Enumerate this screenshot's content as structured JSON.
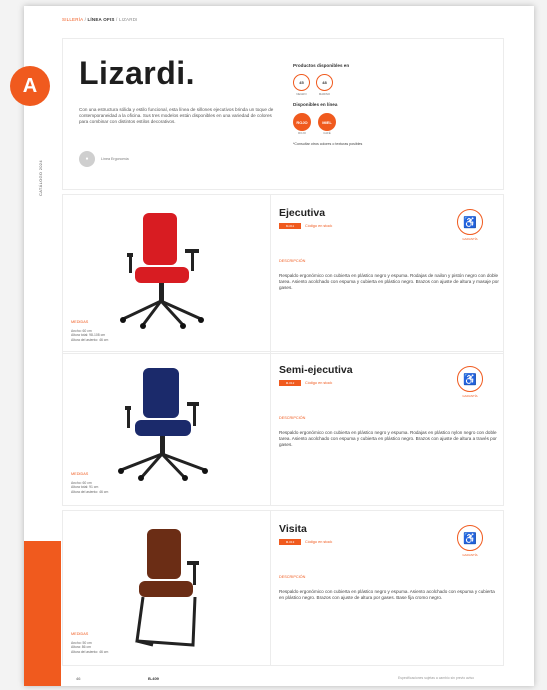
{
  "badge": "A",
  "side_label": "CATÁLOGO 2024",
  "breadcrumb": {
    "part1": "SILLERÍA",
    "part2": "LÍNEA OFIS",
    "part3": "LIZARDI"
  },
  "hero": {
    "title": "Lizardi.",
    "intro": "Con una estructura sólida y estilo funcional, esta línea de sillones ejecutivos brinda un toque de contemporaneidad a la oficina. Sus tres modelos están disponibles en una variedad de colores para combinar con distintos estilos decorativos.",
    "logo_text": "Línea Ergonomía"
  },
  "availability": {
    "title": "Productos disponibles en",
    "rings": [
      {
        "code": "45",
        "caption": "NEGRO"
      },
      {
        "code": "48",
        "caption": "MARINO"
      }
    ],
    "finish_title": "Disponibles en línea",
    "fills": [
      {
        "code": "ROJO",
        "caption": "ROJO"
      },
      {
        "code": "MIEL",
        "caption": "CAFÉ"
      }
    ],
    "note": "*Consultar otros colores o texturas posibles"
  },
  "products": [
    {
      "name": "Ejecutiva",
      "code": "M-011",
      "code_text": "Código en stock",
      "desc_label": "DESCRIPCIÓN",
      "desc": "Respaldo ergonómico con cubierta en plástico negro y espuma. Rodajas de nailon y pistón negro con doble tarea. Asiento acolchado con espuma y cubierta en plástico negro. Brazos con ajuste de altura y masaje por gases.",
      "spec_label": "MEDIDAS",
      "specs": [
        "Ancho: 60 cm",
        "Altura total: 98-108 cm",
        "Altura del asiento: 46 cm"
      ],
      "warranty": "GARANTÍA",
      "color": "#d81c22"
    },
    {
      "name": "Semi-ejecutiva",
      "code": "M-012",
      "code_text": "Código en stock",
      "desc_label": "DESCRIPCIÓN",
      "desc": "Respaldo ergonómico con cubierta en plástico negro y espuma. Rodajas en plástico nylon negro con doble tarea. Asiento acolchado con espuma y cubierta en plástico negro. Brazos con ajuste de altura a través por gases.",
      "spec_label": "MEDIDAS",
      "specs": [
        "Ancho: 60 cm",
        "Altura total: 91 cm",
        "Altura del asiento: 46 cm"
      ],
      "warranty": "GARANTÍA",
      "color": "#1b2a6b"
    },
    {
      "name": "Visita",
      "code": "M-013",
      "code_text": "Código en stock",
      "desc_label": "DESCRIPCIÓN",
      "desc": "Respaldo ergonómico con cubierta en plástico negro y espuma. Asiento acolchado con espuma y cubierta en plástico negro. Brazos con ajuste de altura por gases. Base fija cromo negro.",
      "spec_label": "MEDIDAS",
      "specs": [
        "Ancho: 50 cm",
        "Altura: 86 cm",
        "Altura del asiento: 46 cm"
      ],
      "warranty": "GARANTÍA",
      "color": "#6b2d15"
    }
  ],
  "footer": {
    "left": "46",
    "mid": "B-409",
    "right": "Especificaciones sujetas a cambio sin previo aviso"
  },
  "colors": {
    "accent": "#f05a1e"
  }
}
